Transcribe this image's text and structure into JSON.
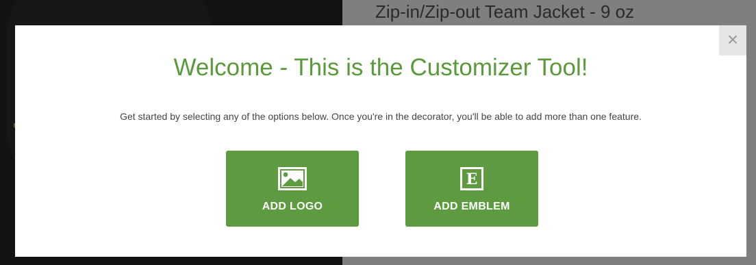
{
  "background": {
    "product_title": "Zip-in/Zip-out Team Jacket - 9 oz"
  },
  "modal": {
    "close_symbol": "×",
    "title": "Welcome - This is the Customizer Tool!",
    "description": "Get started by selecting any of the options below. Once you're in the decorator, you'll be able to add more than one feature.",
    "options": [
      {
        "label": "ADD LOGO",
        "icon": "image-icon"
      },
      {
        "label": "ADD EMBLEM",
        "icon": "emblem-e-icon",
        "glyph": "E"
      }
    ]
  },
  "colors": {
    "accent_green": "#5e9a3f",
    "title_green": "#5a9a3a"
  }
}
